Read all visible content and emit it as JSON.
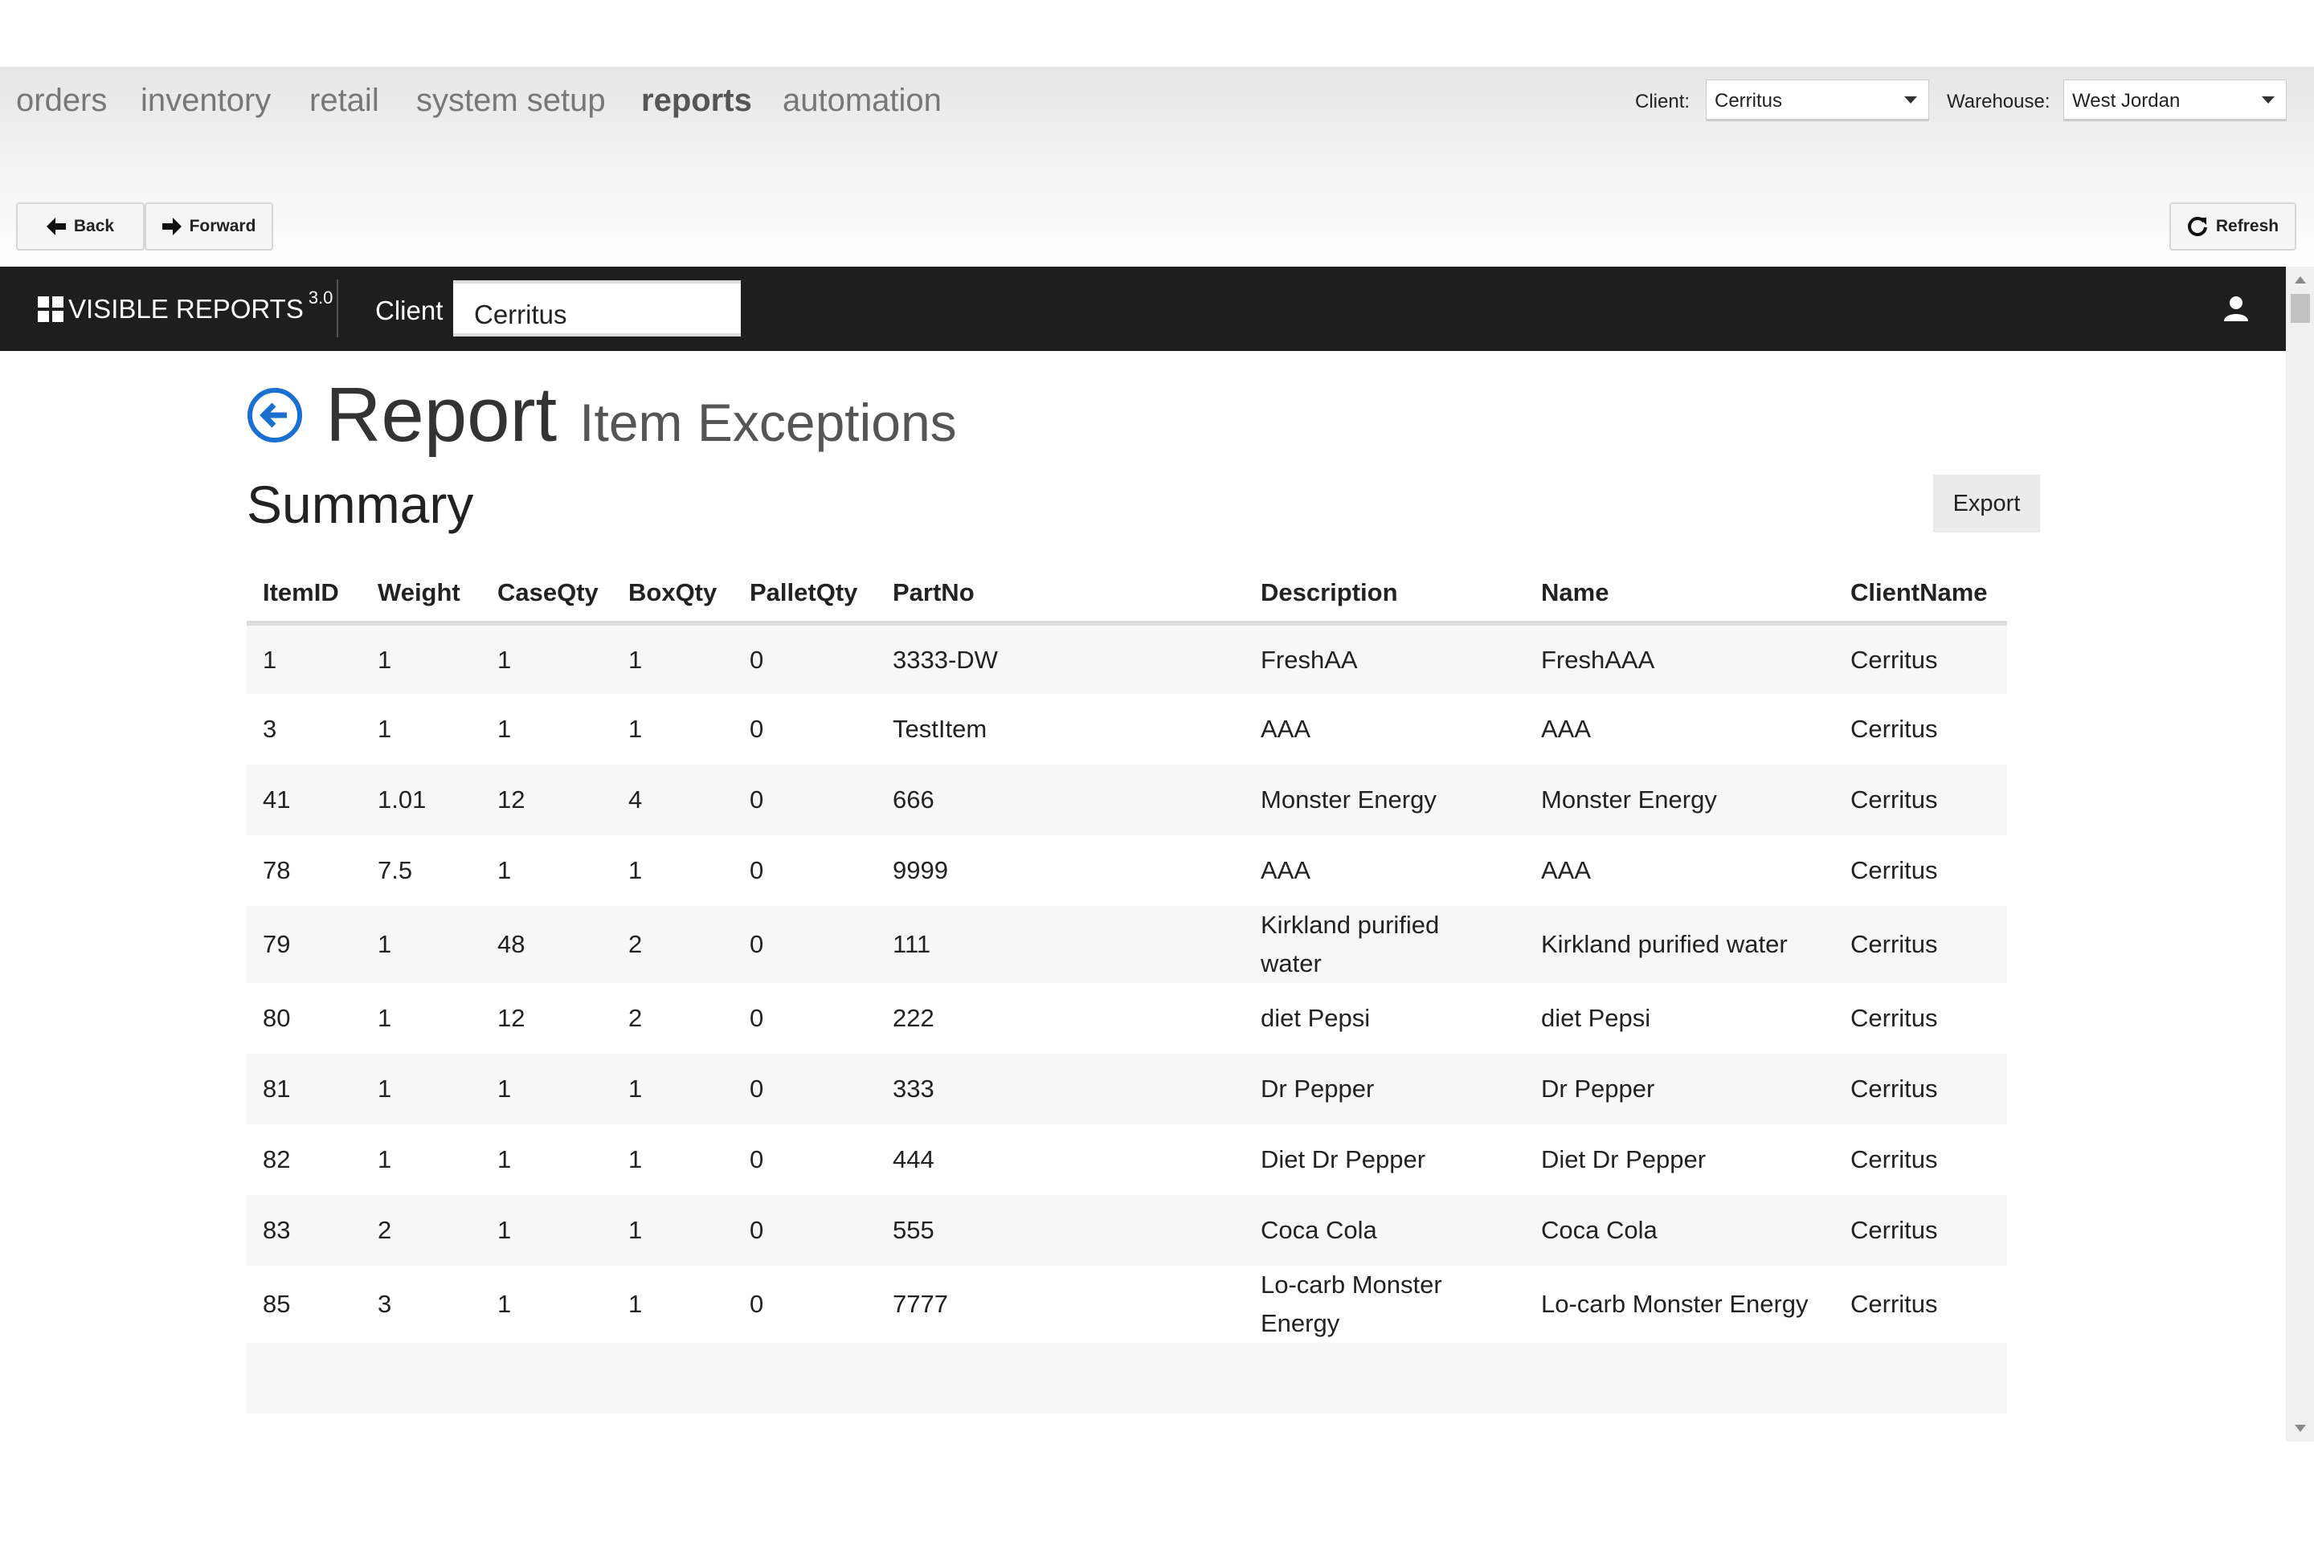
{
  "nav": {
    "items": [
      "orders",
      "inventory",
      "retail",
      "system setup",
      "reports",
      "automation"
    ],
    "active": "reports"
  },
  "selectors": {
    "client_label": "Client:",
    "client_value": "Cerritus",
    "warehouse_label": "Warehouse:",
    "warehouse_value": "West Jordan"
  },
  "toolbar": {
    "back": "Back",
    "forward": "Forward",
    "refresh": "Refresh"
  },
  "app": {
    "name": "VISIBLE REPORTS",
    "version": "3.0",
    "client_label": "Client",
    "client_value": "Cerritus"
  },
  "page": {
    "title": "Report",
    "subtitle": "Item Exceptions",
    "section": "Summary",
    "export": "Export"
  },
  "table": {
    "columns": [
      "ItemID",
      "Weight",
      "CaseQty",
      "BoxQty",
      "PalletQty",
      "PartNo",
      "Description",
      "Name",
      "ClientName"
    ],
    "rows": [
      [
        "1",
        "1",
        "1",
        "1",
        "0",
        "3333-DW",
        "FreshAA",
        "FreshAAA",
        "Cerritus"
      ],
      [
        "3",
        "1",
        "1",
        "1",
        "0",
        "TestItem",
        "AAA",
        "AAA",
        "Cerritus"
      ],
      [
        "41",
        "1.01",
        "12",
        "4",
        "0",
        "666",
        "Monster Energy",
        "Monster Energy",
        "Cerritus"
      ],
      [
        "78",
        "7.5",
        "1",
        "1",
        "0",
        "9999",
        "AAA",
        "AAA",
        "Cerritus"
      ],
      [
        "79",
        "1",
        "48",
        "2",
        "0",
        "111",
        "Kirkland purified water",
        "Kirkland purified water",
        "Cerritus"
      ],
      [
        "80",
        "1",
        "12",
        "2",
        "0",
        "222",
        "diet Pepsi",
        "diet Pepsi",
        "Cerritus"
      ],
      [
        "81",
        "1",
        "1",
        "1",
        "0",
        "333",
        "Dr Pepper",
        "Dr Pepper",
        "Cerritus"
      ],
      [
        "82",
        "1",
        "1",
        "1",
        "0",
        "444",
        "Diet Dr Pepper",
        "Diet Dr Pepper",
        "Cerritus"
      ],
      [
        "83",
        "2",
        "1",
        "1",
        "0",
        "555",
        "Coca Cola",
        "Coca Cola",
        "Cerritus"
      ],
      [
        "85",
        "3",
        "1",
        "1",
        "0",
        "7777",
        "Lo-carb Monster Energy",
        "Lo-carb Monster Energy",
        "Cerritus"
      ]
    ]
  },
  "colors": {
    "appbar": "#1e1e1e",
    "accent": "#1a6fd1",
    "stripe": "#f7f7f7"
  }
}
